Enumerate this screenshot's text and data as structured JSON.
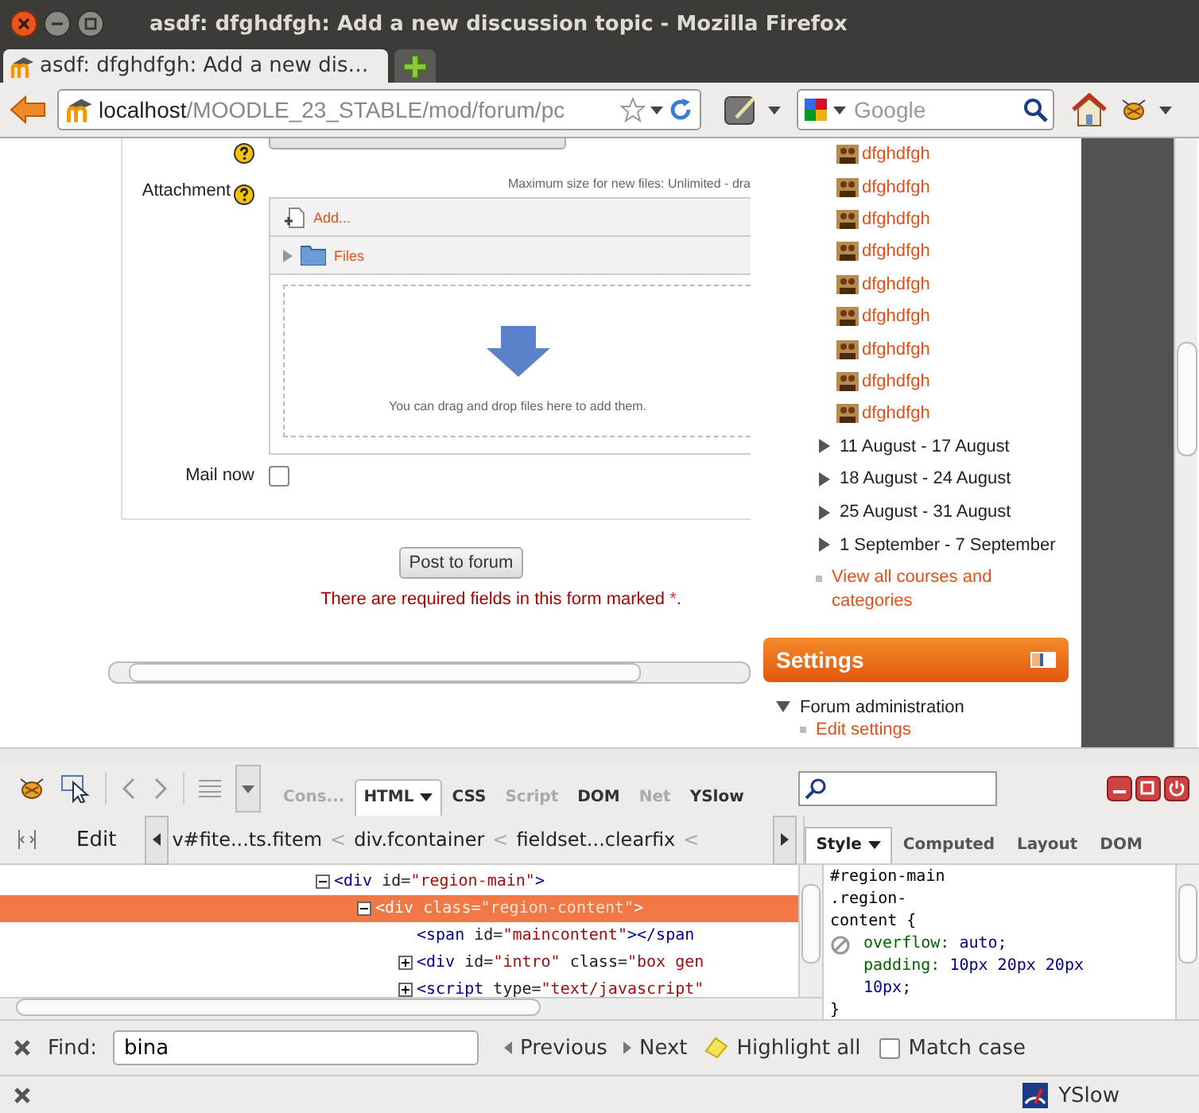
{
  "window": {
    "title": "asdf: dfghdfgh: Add a new discussion topic - Mozilla Firefox"
  },
  "tabs": [
    {
      "label": "asdf: dfghdfgh: Add a new dis…",
      "selected": true
    }
  ],
  "address_bar": {
    "host": "localhost",
    "path": "/MOODLE_23_STABLE/mod/forum/pc"
  },
  "search": {
    "placeholder": "Google"
  },
  "form": {
    "attachment_label": "Attachment",
    "max_size_note": "Maximum size for new files: Unlimited - dra",
    "add_link": "Add...",
    "files_folder": "Files",
    "dropzone_text": "You can drag and drop files here to add them.",
    "mail_now": {
      "label": "Mail now",
      "checked": false
    },
    "submit": "Post to forum",
    "required_note": {
      "text": "There are required fields in this form marked",
      "mark": "*",
      "end": "."
    }
  },
  "sidebar": {
    "links": [
      "dfghdfgh",
      "dfghdfgh",
      "dfghdfgh",
      "dfghdfgh",
      "dfghdfgh",
      "dfghdfgh",
      "dfghdfgh",
      "dfghdfgh",
      "dfghdfgh"
    ],
    "weeks": [
      {
        "label": "11 August - 17 August",
        "expanded": false
      },
      {
        "label": "18 August - 24 August",
        "expanded": false
      },
      {
        "label": "25 August - 31 August",
        "expanded": false
      },
      {
        "label": "1 September - 7 September",
        "expanded": false
      }
    ],
    "view_all": "View all courses and categories",
    "settings": {
      "title": "Settings",
      "items": [
        {
          "label": "Forum administration",
          "expanded": true,
          "children": [
            {
              "label": "Edit settings"
            }
          ]
        }
      ]
    }
  },
  "firebug": {
    "tabs": [
      {
        "label": "Cons...",
        "selected": false,
        "disabled": true,
        "menu": false
      },
      {
        "label": "HTML",
        "selected": true,
        "disabled": false,
        "menu": true
      },
      {
        "label": "CSS",
        "selected": false,
        "disabled": false,
        "menu": false
      },
      {
        "label": "Script",
        "selected": false,
        "disabled": true,
        "menu": false
      },
      {
        "label": "DOM",
        "selected": false,
        "disabled": false,
        "menu": false
      },
      {
        "label": "Net",
        "selected": false,
        "disabled": true,
        "menu": false
      },
      {
        "label": "YSlow",
        "selected": false,
        "disabled": false,
        "menu": false
      }
    ],
    "edit_button": "Edit",
    "breadcrumbs": [
      {
        "label": "v#fite...ts.fitem"
      },
      {
        "label": "div.fcontainer"
      },
      {
        "label": "fieldset...clearfix"
      }
    ],
    "separator": "<",
    "side_tabs": [
      {
        "label": "Style",
        "selected": true,
        "menu": true
      },
      {
        "label": "Computed",
        "selected": false,
        "menu": false
      },
      {
        "label": "Layout",
        "selected": false,
        "menu": false
      },
      {
        "label": "DOM",
        "selected": false,
        "menu": false
      }
    ],
    "html_tree": [
      {
        "kind": "element",
        "expanded": true,
        "selected": false,
        "tokens": [
          {
            "kind": "tag",
            "text": "<div"
          },
          {
            "kind": "attr",
            "text": " id="
          },
          {
            "kind": "value",
            "text": "\"region-main\""
          },
          {
            "kind": "tag",
            "text": ">"
          }
        ],
        "children": [
          {
            "kind": "element",
            "expanded": true,
            "selected": true,
            "tokens": [
              {
                "kind": "tag",
                "text": "<div"
              },
              {
                "kind": "attr",
                "text": " class="
              },
              {
                "kind": "value",
                "text": "\"region-content\""
              },
              {
                "kind": "tag",
                "text": ">"
              }
            ],
            "children": [
              {
                "kind": "leaf",
                "selected": false,
                "tokens": [
                  {
                    "kind": "tag",
                    "text": "<span"
                  },
                  {
                    "kind": "attr",
                    "text": " id="
                  },
                  {
                    "kind": "value",
                    "text": "\"maincontent\""
                  },
                  {
                    "kind": "tag",
                    "text": "></span"
                  }
                ]
              },
              {
                "kind": "element",
                "expanded": false,
                "selected": false,
                "tokens": [
                  {
                    "kind": "tag",
                    "text": "<div"
                  },
                  {
                    "kind": "attr",
                    "text": " id="
                  },
                  {
                    "kind": "value",
                    "text": "\"intro\""
                  },
                  {
                    "kind": "attr",
                    "text": " class="
                  },
                  {
                    "kind": "value",
                    "text": "\"box gen"
                  }
                ]
              },
              {
                "kind": "element",
                "expanded": false,
                "selected": false,
                "tokens": [
                  {
                    "kind": "tag",
                    "text": "<script"
                  },
                  {
                    "kind": "attr",
                    "text": " type="
                  },
                  {
                    "kind": "value",
                    "text": "\"text/javascript\""
                  }
                ]
              }
            ]
          }
        ]
      }
    ],
    "css_rule": {
      "selector": "#region-main .region-content",
      "open": "{",
      "close": "}",
      "properties": [
        {
          "name": "overflow:",
          "value": "auto;",
          "disabled": true
        },
        {
          "name": "padding:",
          "value": "10px 20px 20px 10px;",
          "disabled": false
        }
      ]
    }
  },
  "find_bar": {
    "label": "Find:",
    "value": "bina",
    "previous": "Previous",
    "next": "Next",
    "highlight_all": "Highlight all",
    "match_case": {
      "label": "Match case",
      "checked": false
    }
  },
  "status_bar": {
    "yslow": "YSlow"
  }
}
